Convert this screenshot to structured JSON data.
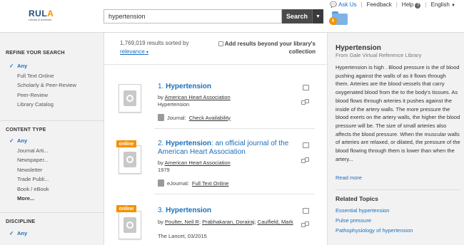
{
  "header": {
    "logo_main_prefix": "RUL",
    "logo_main_accent": "A",
    "logo_sub": "Library & Archives",
    "search_value": "hypertension",
    "search_button": "Search",
    "folder_count": "0",
    "ask_us": "Ask Us",
    "feedback": "Feedback",
    "help": "Help",
    "language": "English"
  },
  "sidebar": {
    "refine_title": "REFINE YOUR SEARCH",
    "refine_items": [
      "Any",
      "Full Text Online",
      "Scholarly & Peer-Review",
      "Peer-Review",
      "Library Catalog"
    ],
    "content_title": "CONTENT TYPE",
    "content_items": [
      "Any",
      "Journal Arti...",
      "Newspaper...",
      "Newsletter",
      "Trade Publi...",
      "Book / eBook",
      "More..."
    ],
    "discipline_title": "DISCIPLINE",
    "discipline_items": [
      "Any"
    ]
  },
  "results": {
    "count": "1,769,019 results sorted by",
    "sort": "relevance",
    "add_results_l1": "Add results beyond your library's",
    "add_results_l2": "collection",
    "online_label": "online",
    "by": "by",
    "items": [
      {
        "num": "1.",
        "title_bold": "Hypertension",
        "title_rest": "",
        "authors": "American Heart Association",
        "source": "Hypertension",
        "type": "Journal:",
        "access": "Check Availability"
      },
      {
        "num": "2.",
        "title_bold": "Hypertension",
        "title_rest": ": an official journal of the American Heart Association",
        "authors": "American Heart Association",
        "source": "1979",
        "type": "eJournal:",
        "access": "Full Text Online"
      },
      {
        "num": "3.",
        "title_bold": "Hypertension",
        "title_rest": "",
        "authors_list": [
          "Poulter, Neil R",
          "Prabhakaran, Dorairaj",
          "Caulfield, Mark"
        ],
        "source": "The Lancet, 03/2015"
      }
    ]
  },
  "topic_panel": {
    "title": "Hypertension",
    "source": "From Gale Virtual Reference Library",
    "text": "Hypertension is high . Blood pressure is the of blood pushing against the walls of as it flows through them. Arteries are the blood vessels that carry oxygenated blood from the to the body's tissues. As blood flows through arteries it pushes against the inside of the artery walls. The more pressure the blood exerts on the artery walls, the higher the blood pressure will be. The size of small arteries also affects the blood pressure. When the muscular walls of arteries are relaxed, or dilated, the pressure of the blood flowing through them is lower than when the artery...",
    "read_more": "Read more",
    "related_title": "Related Topics",
    "related": [
      "Essential hypertension",
      "Pulse pressure",
      "Pathophysiology of hypertension"
    ]
  }
}
